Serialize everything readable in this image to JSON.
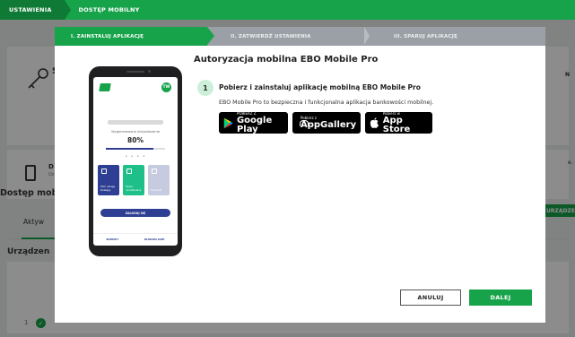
{
  "breadcrumb": {
    "item1": "USTAWIENIA",
    "item2": "DOSTĘP MOBILNY"
  },
  "background": {
    "section_title": "Dostęp mobi",
    "tab_label": "Aktyw",
    "devices_title": "Urządzen",
    "action_button": "URZĄDZENI",
    "row_number": "1",
    "partial_letter_s": "S",
    "partial_letter_d": "D",
    "partial_small_u": "Uz",
    "partial_n": "N",
    "partial_e": "e."
  },
  "steps": [
    {
      "label": "I. ZAINSTALUJ APLIKACJĘ"
    },
    {
      "label": "II. ZATWIERDŹ USTAWIENIA"
    },
    {
      "label": "III. SPARUJ APLIKACJĘ"
    }
  ],
  "phone": {
    "avatar": "TW",
    "label": "Wygenerowano indywidualnie",
    "percent": "80%",
    "progress": 0.8,
    "dots": "• • • •",
    "tile1": "Zleć usługę\nDostępy",
    "tile2": "Twoje\nna kalkulacji",
    "tile3": "Sprawdź",
    "button": "ZALOGUJ SIĘ",
    "bottom_left": "KONTAKT",
    "bottom_right": "BLOKADA KART"
  },
  "content": {
    "title": "Autoryzacja mobilna EBO Mobile Pro",
    "step_number": "1",
    "step_heading": "Pobierz i zainstaluj aplikację mobilną EBO Mobile Pro",
    "description": "EBO Mobile Pro to bezpieczna i funkcjonalna aplikacja bankowości mobilnej."
  },
  "stores": {
    "google": {
      "small": "POBIERZ Z",
      "big": "Google Play"
    },
    "huawei": {
      "small": "Pobierz z",
      "big": "AppGallery"
    },
    "apple": {
      "small": "Pobierz w",
      "big": "App Store"
    }
  },
  "buttons": {
    "cancel": "ANULUJ",
    "next": "DALEJ"
  },
  "colors": {
    "green": "#16a34a",
    "dark_green": "#0f7a35",
    "navy": "#2e3e92"
  }
}
